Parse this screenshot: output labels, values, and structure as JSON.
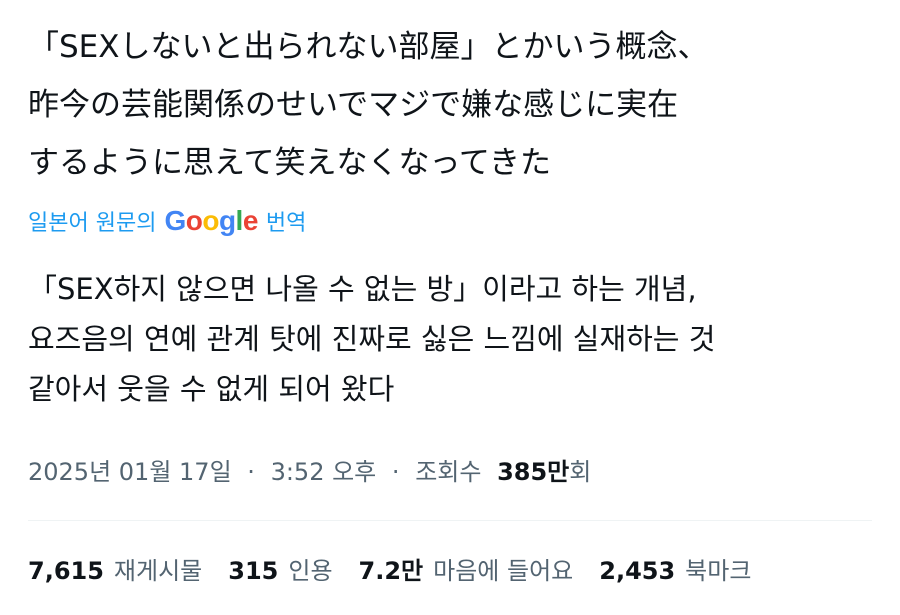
{
  "original_text": {
    "lines": [
      "「SEXしないと出られない部屋」とかいう概念、",
      "昨今の芸能関係のせいでマジで嫌な感じに実在",
      "するように思えて笑えなくなってきた"
    ]
  },
  "translation_notice": {
    "prefix": "일본어 원문의",
    "google": [
      "G",
      "o",
      "o",
      "g",
      "l",
      "e"
    ],
    "suffix": "번역",
    "colors": [
      "#4285f4",
      "#ea4335",
      "#fbbc05",
      "#4285f4",
      "#34a853",
      "#ea4335"
    ]
  },
  "translated_text": {
    "lines": [
      "「SEX하지 않으면 나올 수 없는 방」이라고 하는 개념,",
      "요즈음의 연예 관계 탓에 진짜로 싫은 느낌에 실재하는 것",
      "같아서 웃을 수 없게 되어 왔다"
    ]
  },
  "meta": {
    "date": "2025년 01월 17일",
    "separator": "·",
    "time": "3:52 오후",
    "views_label": "조회수",
    "views_count": "385만",
    "views_suffix": "회"
  },
  "stats": [
    {
      "value": "7,615",
      "label": "재게시물"
    },
    {
      "value": "315",
      "label": "인용"
    },
    {
      "value": "7.2만",
      "label": "마음에 들어요"
    },
    {
      "value": "2,453",
      "label": "북마크"
    }
  ],
  "colors": {
    "text": "#0f1419",
    "secondary": "#536471",
    "link": "#1d9bf0",
    "divider": "#eff3f4"
  }
}
